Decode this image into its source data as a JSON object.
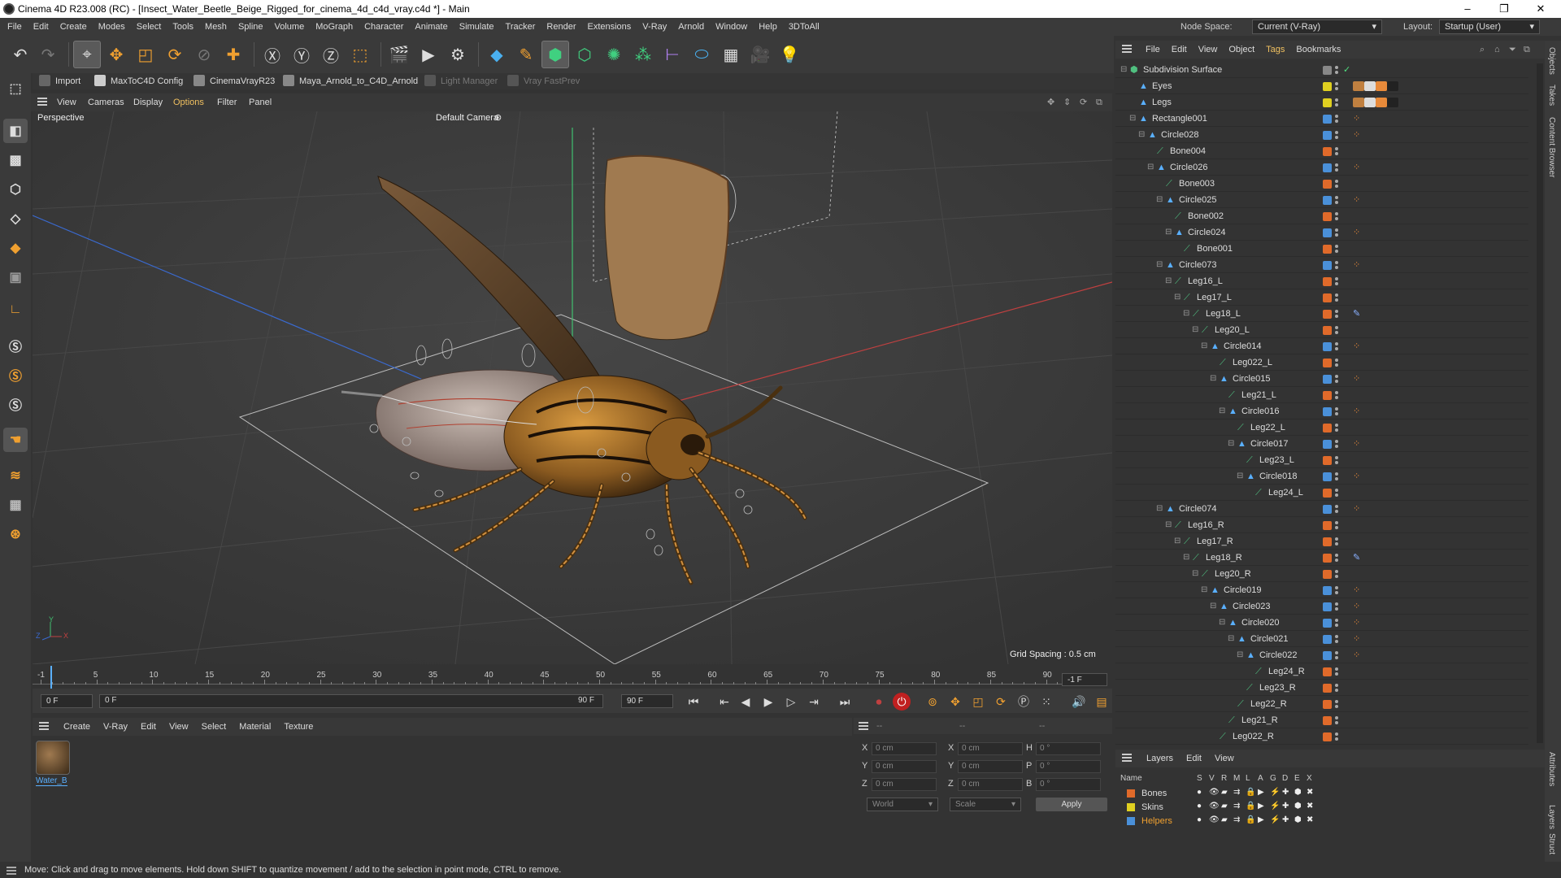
{
  "window": {
    "title": "Cinema 4D R23.008 (RC) - [Insect_Water_Beetle_Beige_Rigged_for_cinema_4d_c4d_vray.c4d *] - Main",
    "controls": [
      "–",
      "❐",
      "✕"
    ]
  },
  "menubar": {
    "items": [
      "File",
      "Edit",
      "Create",
      "Modes",
      "Select",
      "Tools",
      "Mesh",
      "Spline",
      "Volume",
      "MoGraph",
      "Character",
      "Animate",
      "Simulate",
      "Tracker",
      "Render",
      "Extensions",
      "V-Ray",
      "Arnold",
      "Window",
      "Help",
      "3DToAll"
    ],
    "node_space_label": "Node Space:",
    "node_space_value": "Current (V-Ray)",
    "layout_label": "Layout:",
    "layout_value": "Startup (User)"
  },
  "command_bar": {
    "import": "Import",
    "maxto": "MaxToC4D Config",
    "cinemavray": "CinemaVrayR23",
    "maya": "Maya_Arnold_to_C4D_Arnold",
    "light": "Light Manager",
    "vray": "Vray FastPrev"
  },
  "viewport_menu": [
    "View",
    "Cameras",
    "Display",
    "Options",
    "Filter",
    "Panel"
  ],
  "viewport": {
    "label": "Perspective",
    "camera": "Default Camera",
    "grid_spacing": "Grid Spacing : 0.5 cm",
    "axis_x": "X",
    "axis_y": "Y",
    "axis_z": "Z"
  },
  "timeline": {
    "ticks": [
      "-1",
      "5",
      "10",
      "15",
      "20",
      "25",
      "30",
      "35",
      "40",
      "45",
      "50",
      "55",
      "60",
      "65",
      "70",
      "75",
      "80",
      "85",
      "90"
    ],
    "end_field": "-1 F",
    "start_frame": "0 F",
    "current_frame": "0 F",
    "range_end": "90 F",
    "max_frame": "90 F"
  },
  "material_menu": [
    "Create",
    "V-Ray",
    "Edit",
    "View",
    "Select",
    "Material",
    "Texture"
  ],
  "material": {
    "name": "Water_B"
  },
  "attributes": {
    "header_dashes": [
      "--",
      "--",
      "--"
    ],
    "rows": [
      {
        "a": "X",
        "av": "0 cm",
        "b": "X",
        "bv": "0 cm",
        "c": "H",
        "cv": "0 °"
      },
      {
        "a": "Y",
        "av": "0 cm",
        "b": "Y",
        "bv": "0 cm",
        "c": "P",
        "cv": "0 °"
      },
      {
        "a": "Z",
        "av": "0 cm",
        "b": "Z",
        "bv": "0 cm",
        "c": "B",
        "cv": "0 °"
      }
    ],
    "world": "World",
    "scale": "Scale",
    "apply": "Apply"
  },
  "object_menu": [
    "File",
    "Edit",
    "View",
    "Object",
    "Tags",
    "Bookmarks"
  ],
  "objects": [
    {
      "name": "Subdivision Surface",
      "color": "#888888",
      "kind": "subd"
    },
    {
      "name": "Eyes",
      "color": "#e0d020",
      "kind": "null"
    },
    {
      "name": "Legs",
      "color": "#e0d020",
      "kind": "null"
    },
    {
      "name": "Rectangle001",
      "color": "#4a90d9",
      "kind": "null"
    },
    {
      "name": "Circle028",
      "color": "#4a90d9",
      "kind": "null"
    },
    {
      "name": "Bone004",
      "color": "#e06a2a",
      "kind": "bone"
    },
    {
      "name": "Circle026",
      "color": "#4a90d9",
      "kind": "null"
    },
    {
      "name": "Bone003",
      "color": "#e06a2a",
      "kind": "bone"
    },
    {
      "name": "Circle025",
      "color": "#4a90d9",
      "kind": "null"
    },
    {
      "name": "Bone002",
      "color": "#e06a2a",
      "kind": "bone"
    },
    {
      "name": "Circle024",
      "color": "#4a90d9",
      "kind": "null"
    },
    {
      "name": "Bone001",
      "color": "#e06a2a",
      "kind": "bone"
    },
    {
      "name": "Circle073",
      "color": "#4a90d9",
      "kind": "null"
    },
    {
      "name": "Leg16_L",
      "color": "#e06a2a",
      "kind": "bone"
    },
    {
      "name": "Leg17_L",
      "color": "#e06a2a",
      "kind": "bone"
    },
    {
      "name": "Leg18_L",
      "color": "#e06a2a",
      "kind": "bone"
    },
    {
      "name": "Leg20_L",
      "color": "#e06a2a",
      "kind": "bone"
    },
    {
      "name": "Circle014",
      "color": "#4a90d9",
      "kind": "null"
    },
    {
      "name": "Leg022_L",
      "color": "#e06a2a",
      "kind": "bone"
    },
    {
      "name": "Circle015",
      "color": "#4a90d9",
      "kind": "null"
    },
    {
      "name": "Leg21_L",
      "color": "#e06a2a",
      "kind": "bone"
    },
    {
      "name": "Circle016",
      "color": "#4a90d9",
      "kind": "null"
    },
    {
      "name": "Leg22_L",
      "color": "#e06a2a",
      "kind": "bone"
    },
    {
      "name": "Circle017",
      "color": "#4a90d9",
      "kind": "null"
    },
    {
      "name": "Leg23_L",
      "color": "#e06a2a",
      "kind": "bone"
    },
    {
      "name": "Circle018",
      "color": "#4a90d9",
      "kind": "null"
    },
    {
      "name": "Leg24_L",
      "color": "#e06a2a",
      "kind": "bone"
    },
    {
      "name": "Circle074",
      "color": "#4a90d9",
      "kind": "null"
    },
    {
      "name": "Leg16_R",
      "color": "#e06a2a",
      "kind": "bone"
    },
    {
      "name": "Leg17_R",
      "color": "#e06a2a",
      "kind": "bone"
    },
    {
      "name": "Leg18_R",
      "color": "#e06a2a",
      "kind": "bone"
    },
    {
      "name": "Leg20_R",
      "color": "#e06a2a",
      "kind": "bone"
    },
    {
      "name": "Circle019",
      "color": "#4a90d9",
      "kind": "null"
    },
    {
      "name": "Circle023",
      "color": "#4a90d9",
      "kind": "null"
    },
    {
      "name": "Circle020",
      "color": "#4a90d9",
      "kind": "null"
    },
    {
      "name": "Circle021",
      "color": "#4a90d9",
      "kind": "null"
    },
    {
      "name": "Circle022",
      "color": "#4a90d9",
      "kind": "null"
    },
    {
      "name": "Leg24_R",
      "color": "#e06a2a",
      "kind": "bone"
    },
    {
      "name": "Leg23_R",
      "color": "#e06a2a",
      "kind": "bone"
    },
    {
      "name": "Leg22_R",
      "color": "#e06a2a",
      "kind": "bone"
    },
    {
      "name": "Leg21_R",
      "color": "#e06a2a",
      "kind": "bone"
    },
    {
      "name": "Leg022_R",
      "color": "#e06a2a",
      "kind": "bone"
    }
  ],
  "layers_menu": [
    "Layers",
    "Edit",
    "View"
  ],
  "layers_header": [
    "Name",
    "S",
    "V",
    "R",
    "M",
    "L",
    "A",
    "G",
    "D",
    "E",
    "X"
  ],
  "layers": [
    {
      "name": "Bones",
      "color": "#e06a2a"
    },
    {
      "name": "Skins",
      "color": "#e0d020"
    },
    {
      "name": "Helpers",
      "color": "#4a90d9"
    }
  ],
  "side_tabs": [
    "Objects",
    "Takes",
    "Content Browser",
    "Attributes",
    "Layers",
    "Struct"
  ],
  "status": "Move: Click and drag to move elements. Hold down SHIFT to quantize movement / add to the selection in point mode, CTRL to remove."
}
